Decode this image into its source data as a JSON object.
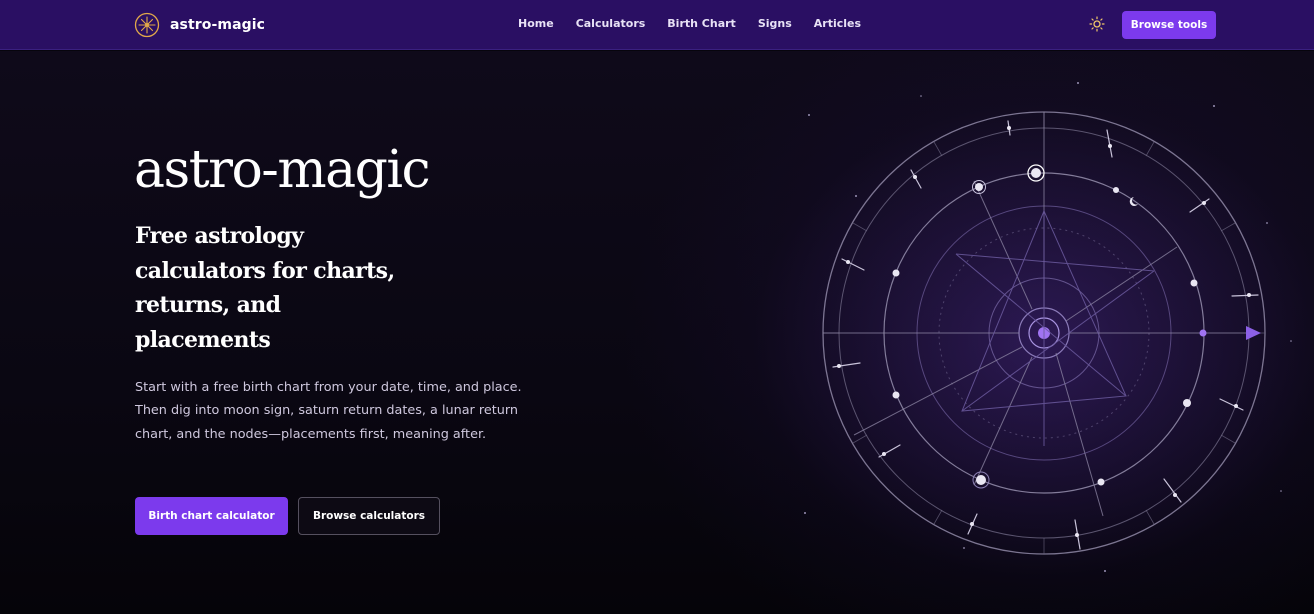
{
  "header": {
    "brand": "astro-magic",
    "nav": [
      "Home",
      "Calculators",
      "Birth Chart",
      "Signs",
      "Articles"
    ],
    "browse_tools": "Browse tools"
  },
  "hero": {
    "title": "astro-magic",
    "subtitle": "Free astrology calculators for charts, returns, and placements",
    "description": "Start with a free birth chart from your date, time, and place. Then dig into moon sign, saturn return dates, a lunar return chart, and the nodes—placements first, meaning after.",
    "primary_button": "Birth chart calculator",
    "secondary_button": "Browse calculators"
  },
  "colors": {
    "accent": "#7c3aed",
    "header_bg": "#2a0f63",
    "page_bg": "#07050d"
  },
  "icons": [
    "star-logo-icon",
    "sun-theme-icon"
  ]
}
